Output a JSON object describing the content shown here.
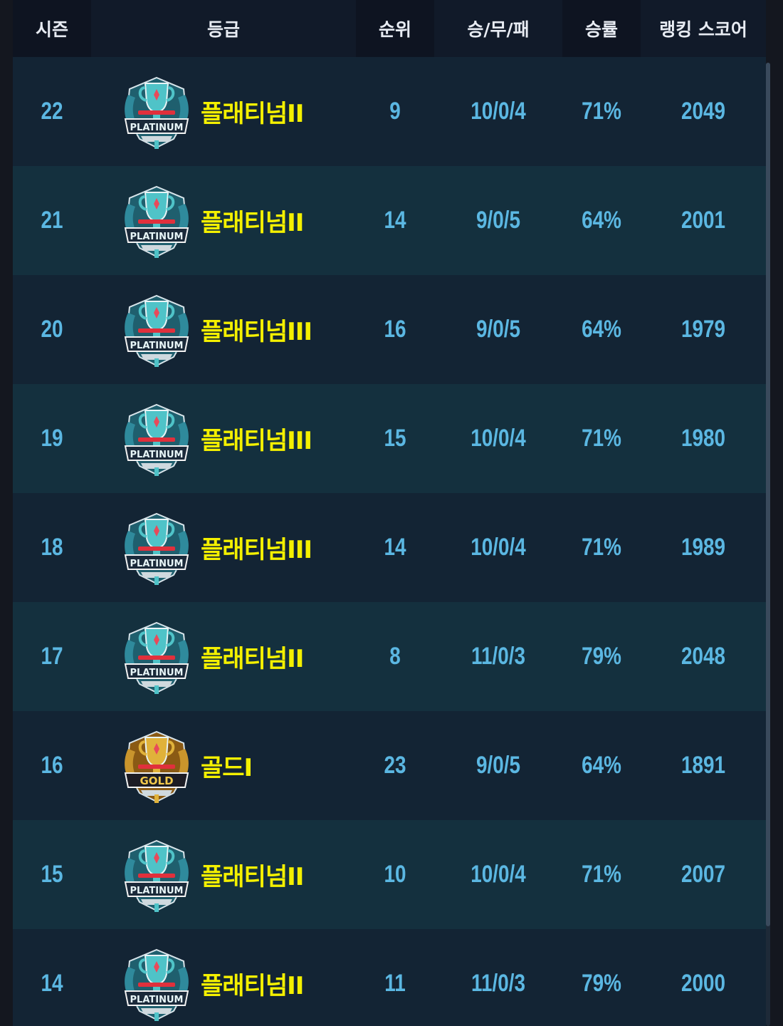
{
  "header": {
    "season": "시즌",
    "grade": "등급",
    "rank": "순위",
    "record": "승/무/패",
    "win_rate": "승률",
    "ranking_score": "랭킹 스코어"
  },
  "rows": [
    {
      "season": "22",
      "badge": "platinum",
      "badge_label": "PLATINUM",
      "grade": "플래티넘II",
      "rank": "9",
      "record": "10/0/4",
      "win_rate": "71%",
      "score": "2049"
    },
    {
      "season": "21",
      "badge": "platinum",
      "badge_label": "PLATINUM",
      "grade": "플래티넘II",
      "rank": "14",
      "record": "9/0/5",
      "win_rate": "64%",
      "score": "2001"
    },
    {
      "season": "20",
      "badge": "platinum",
      "badge_label": "PLATINUM",
      "grade": "플래티넘III",
      "rank": "16",
      "record": "9/0/5",
      "win_rate": "64%",
      "score": "1979"
    },
    {
      "season": "19",
      "badge": "platinum",
      "badge_label": "PLATINUM",
      "grade": "플래티넘III",
      "rank": "15",
      "record": "10/0/4",
      "win_rate": "71%",
      "score": "1980"
    },
    {
      "season": "18",
      "badge": "platinum",
      "badge_label": "PLATINUM",
      "grade": "플래티넘III",
      "rank": "14",
      "record": "10/0/4",
      "win_rate": "71%",
      "score": "1989"
    },
    {
      "season": "17",
      "badge": "platinum",
      "badge_label": "PLATINUM",
      "grade": "플래티넘II",
      "rank": "8",
      "record": "11/0/3",
      "win_rate": "79%",
      "score": "2048"
    },
    {
      "season": "16",
      "badge": "gold",
      "badge_label": "GOLD",
      "grade": "골드I",
      "rank": "23",
      "record": "9/0/5",
      "win_rate": "64%",
      "score": "1891"
    },
    {
      "season": "15",
      "badge": "platinum",
      "badge_label": "PLATINUM",
      "grade": "플래티넘II",
      "rank": "10",
      "record": "10/0/4",
      "win_rate": "71%",
      "score": "2007"
    },
    {
      "season": "14",
      "badge": "platinum",
      "badge_label": "PLATINUM",
      "grade": "플래티넘II",
      "rank": "11",
      "record": "11/0/3",
      "win_rate": "79%",
      "score": "2000"
    }
  ],
  "colors": {
    "value_text": "#5bb7e2",
    "grade_text": "#f4f000",
    "platinum_badge": "#4fc3c8",
    "gold_badge": "#e0b23a"
  },
  "icons": {
    "platinum": "platinum-tier-badge-icon",
    "gold": "gold-tier-badge-icon"
  }
}
